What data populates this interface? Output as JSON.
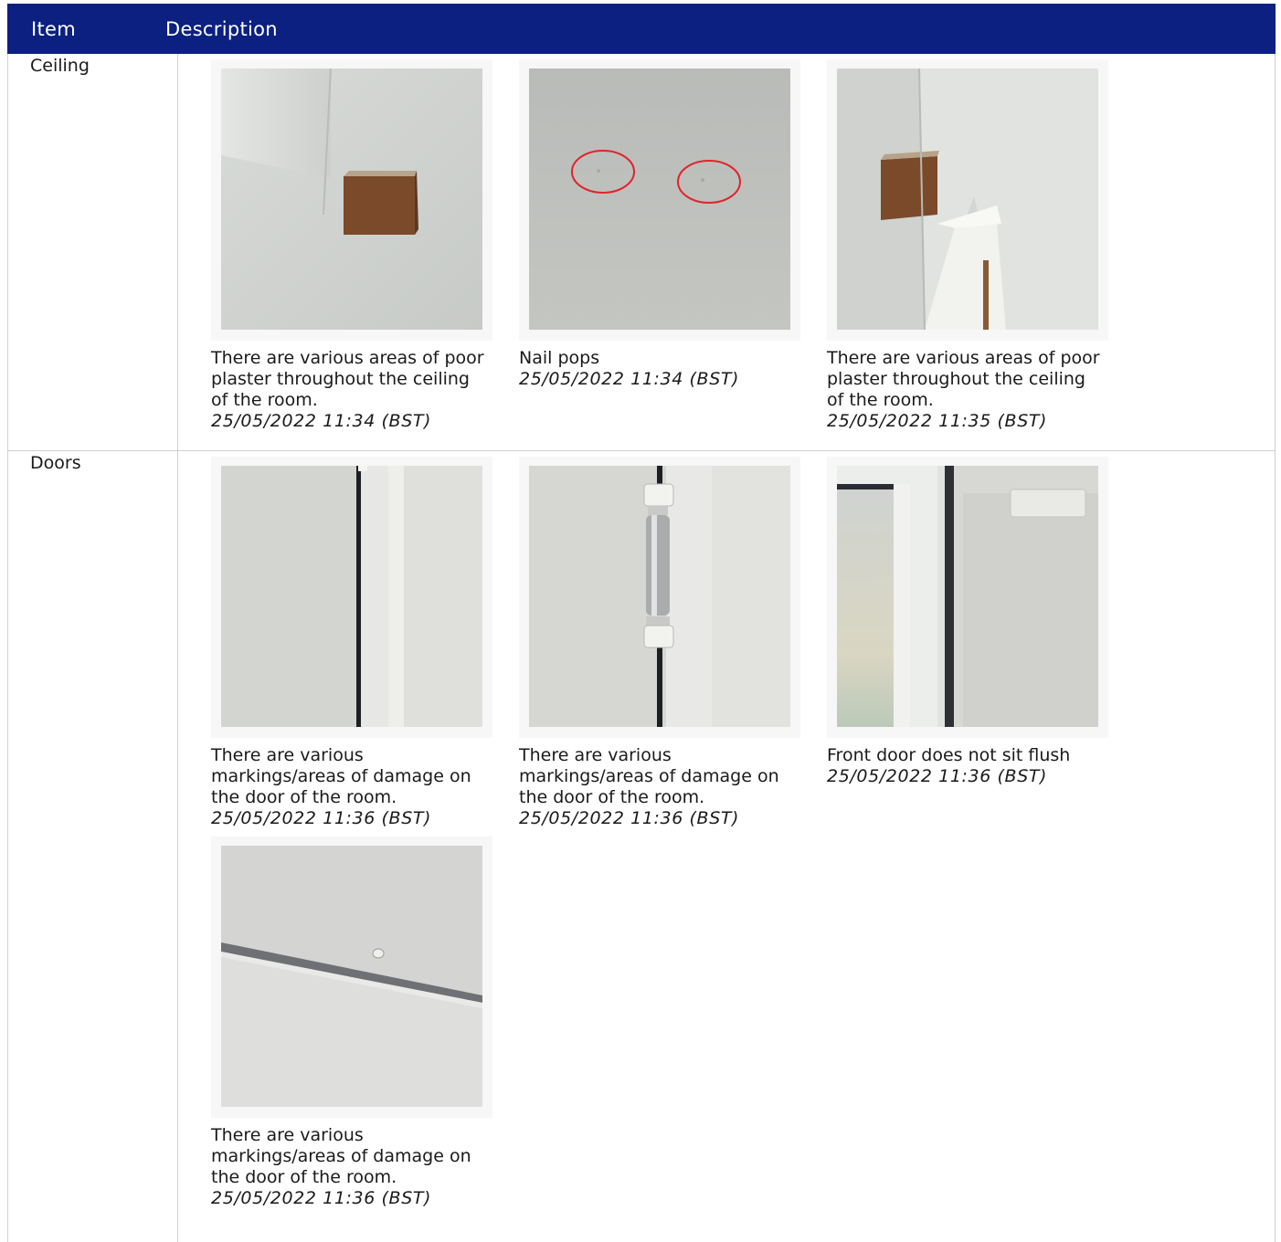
{
  "table": {
    "header": {
      "item": "Item",
      "description": "Description"
    },
    "sections": [
      {
        "item": "Ceiling",
        "photos": [
          {
            "caption": "There are various areas of poor plaster throughout the ceiling of the room.",
            "timestamp": "25/05/2022 11:34 (BST)",
            "image": "ceiling-wood-block"
          },
          {
            "caption": "Nail pops",
            "timestamp": "25/05/2022 11:34 (BST)",
            "image": "ceiling-nail-pops-circled"
          },
          {
            "caption": "There are various areas of poor plaster throughout the ceiling of the room.",
            "timestamp": "25/05/2022 11:35 (BST)",
            "image": "ceiling-wood-block-corner"
          }
        ]
      },
      {
        "item": "Doors",
        "photos": [
          {
            "caption": "There are various markings/areas of damage on the door of the room.",
            "timestamp": "25/05/2022 11:36 (BST)",
            "image": "door-edge-gap"
          },
          {
            "caption": "There are various markings/areas of damage on the door of the room.",
            "timestamp": "25/05/2022 11:36 (BST)",
            "image": "door-hinge"
          },
          {
            "caption": "Front door does not sit flush",
            "timestamp": "25/05/2022 11:36 (BST)",
            "image": "front-door-frame"
          },
          {
            "caption": "There are various markings/areas of damage on the door of the room.",
            "timestamp": "25/05/2022 11:36 (BST)",
            "image": "door-top-edge"
          }
        ]
      }
    ]
  }
}
